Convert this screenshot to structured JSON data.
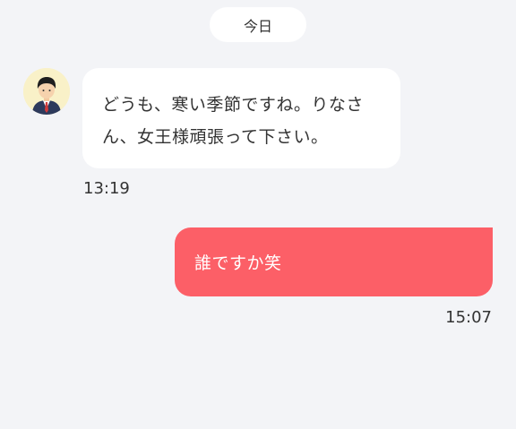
{
  "date_divider": {
    "label": "今日"
  },
  "messages": [
    {
      "direction": "incoming",
      "lines": [
        "どうも、寒い季節ですね。りなさ",
        "ん、女王様頑張って下さい。"
      ],
      "time": "13:19"
    },
    {
      "direction": "outgoing",
      "text": "誰ですか笑",
      "time": "15:07"
    }
  ],
  "colors": {
    "background": "#f3f4f7",
    "incoming_bubble": "#ffffff",
    "outgoing_bubble": "#fc5f67",
    "avatar_bg": "#f9f1c8"
  },
  "icons": {
    "avatar": "avatar-businessman-icon"
  }
}
